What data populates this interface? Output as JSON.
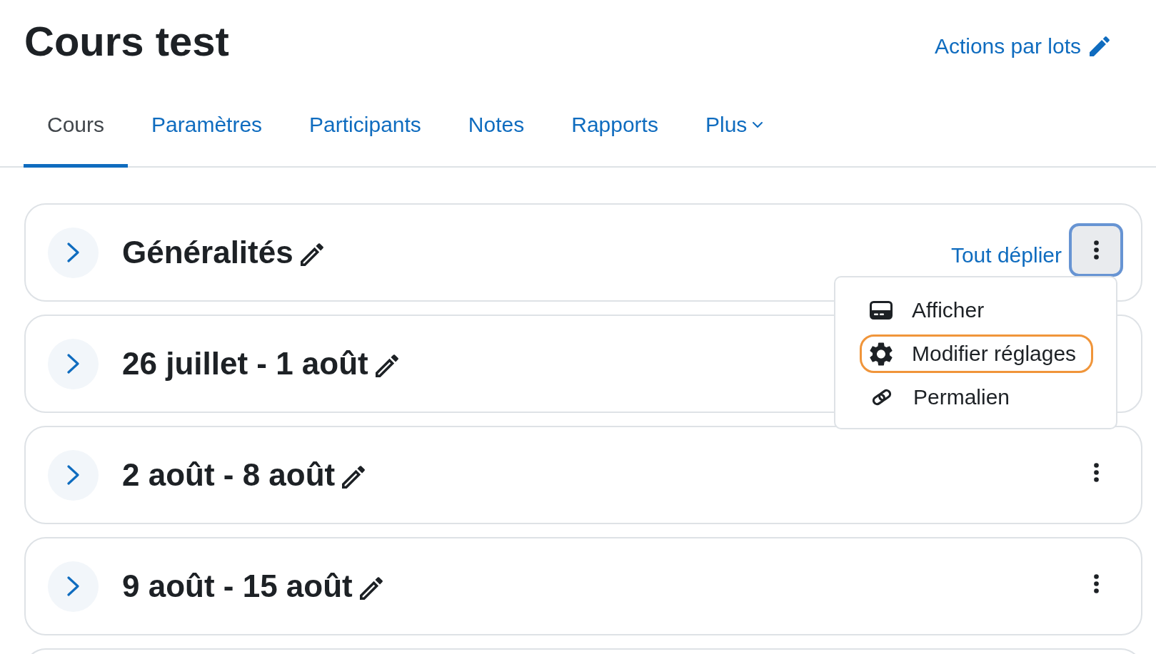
{
  "header": {
    "title": "Cours test",
    "bulk_actions_link": "Actions par lots"
  },
  "tabs": [
    {
      "label": "Cours",
      "selected": true,
      "kind": "link"
    },
    {
      "label": "Paramètres",
      "selected": false,
      "kind": "link"
    },
    {
      "label": "Participants",
      "selected": false,
      "kind": "link"
    },
    {
      "label": "Notes",
      "selected": false,
      "kind": "link"
    },
    {
      "label": "Rapports",
      "selected": false,
      "kind": "link"
    },
    {
      "label": "Plus",
      "selected": false,
      "kind": "dropdown"
    }
  ],
  "sections": [
    {
      "title": "Généralités",
      "expanded": false,
      "expand_all_link": "Tout déplier",
      "menu_open": true
    },
    {
      "title": "26 juillet - 1 août",
      "expanded": false,
      "menu_open": false
    },
    {
      "title": "2 août - 8 août",
      "expanded": false,
      "menu_open": false
    },
    {
      "title": "9 août - 15 août",
      "expanded": false,
      "menu_open": false
    }
  ],
  "section_menu": {
    "items": [
      {
        "label": "Afficher",
        "kind": "show",
        "highlighted": false
      },
      {
        "label": "Modifier réglages",
        "kind": "settings",
        "highlighted": true
      },
      {
        "label": "Permalien",
        "kind": "link",
        "highlighted": false
      }
    ]
  }
}
